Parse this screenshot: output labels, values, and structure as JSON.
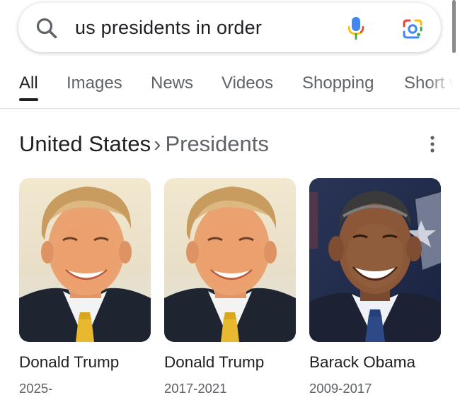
{
  "search": {
    "query": "us presidents in order"
  },
  "tabs": [
    {
      "label": "All",
      "active": true
    },
    {
      "label": "Images",
      "active": false
    },
    {
      "label": "News",
      "active": false
    },
    {
      "label": "Videos",
      "active": false
    },
    {
      "label": "Shopping",
      "active": false
    },
    {
      "label": "Short v",
      "active": false
    }
  ],
  "breadcrumb": {
    "level1": "United States",
    "separator": "›",
    "level2": "Presidents"
  },
  "presidents": [
    {
      "name": "Donald Trump",
      "years": "2025-"
    },
    {
      "name": "Donald Trump",
      "years": "2017-2021"
    },
    {
      "name": "Barack Obama",
      "years": "2009-2017"
    }
  ],
  "icons": {
    "search": "search-icon",
    "mic": "mic-icon",
    "lens": "lens-icon",
    "more": "more-vert-icon"
  },
  "colors": {
    "text_primary": "#202124",
    "text_secondary": "#5f6368",
    "google_blue": "#4285F4",
    "google_red": "#EA4335",
    "google_yellow": "#FBBC05",
    "google_green": "#34A853"
  }
}
